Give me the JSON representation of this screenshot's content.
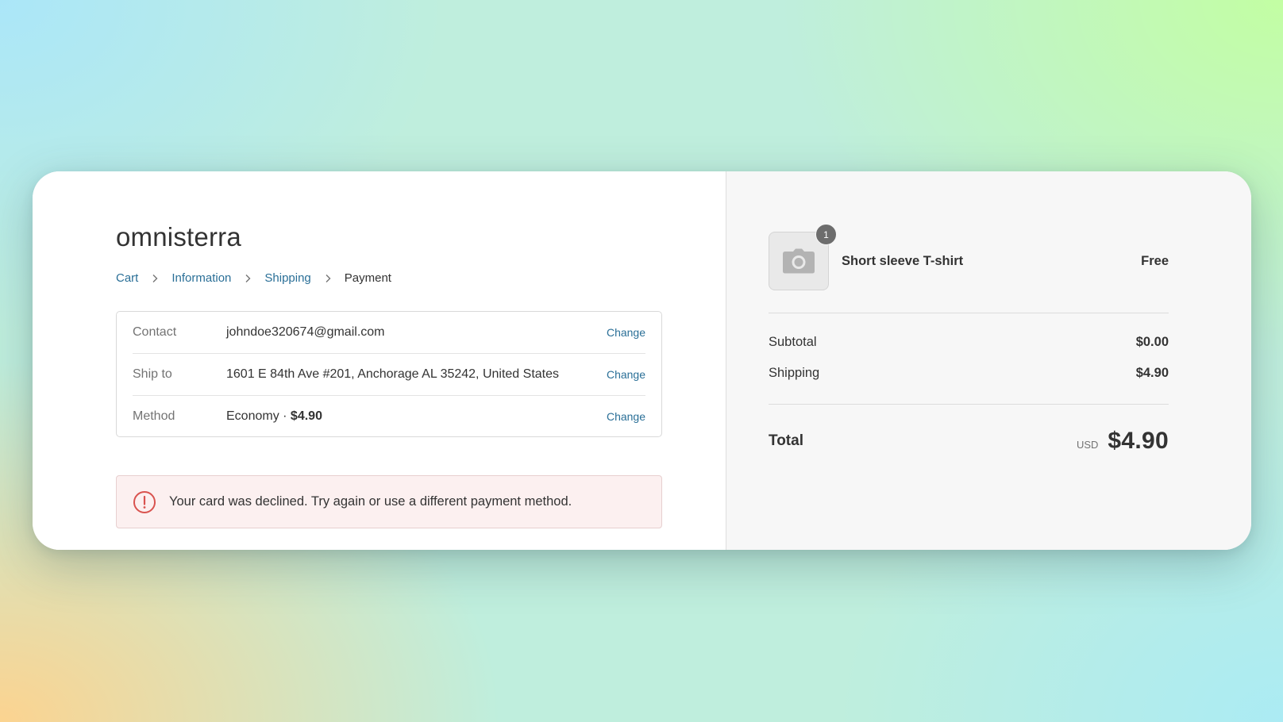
{
  "store": {
    "name": "omnisterra"
  },
  "breadcrumb": {
    "items": [
      {
        "label": "Cart",
        "link": true
      },
      {
        "label": "Information",
        "link": true
      },
      {
        "label": "Shipping",
        "link": true
      },
      {
        "label": "Payment",
        "link": false
      }
    ]
  },
  "review": {
    "contact": {
      "label": "Contact",
      "value": "johndoe320674@gmail.com",
      "action": "Change"
    },
    "ship_to": {
      "label": "Ship to",
      "value": "1601 E 84th Ave #201, Anchorage AL 35242, United States",
      "action": "Change"
    },
    "method": {
      "label": "Method",
      "name": "Economy",
      "separator": " · ",
      "price": "$4.90",
      "action": "Change"
    }
  },
  "error": {
    "message": "Your card was declined. Try again or use a different payment method.",
    "color": "#d9534f"
  },
  "order": {
    "product": {
      "name": "Short sleeve T-shirt",
      "price": "Free",
      "quantity": "1",
      "image_icon": "camera-icon"
    },
    "subtotal": {
      "label": "Subtotal",
      "amount": "$0.00"
    },
    "shipping": {
      "label": "Shipping",
      "amount": "$4.90"
    },
    "total": {
      "label": "Total",
      "currency": "USD",
      "amount": "$4.90"
    }
  },
  "colors": {
    "link": "#2a6f97",
    "error_background": "#fcf0f0"
  }
}
